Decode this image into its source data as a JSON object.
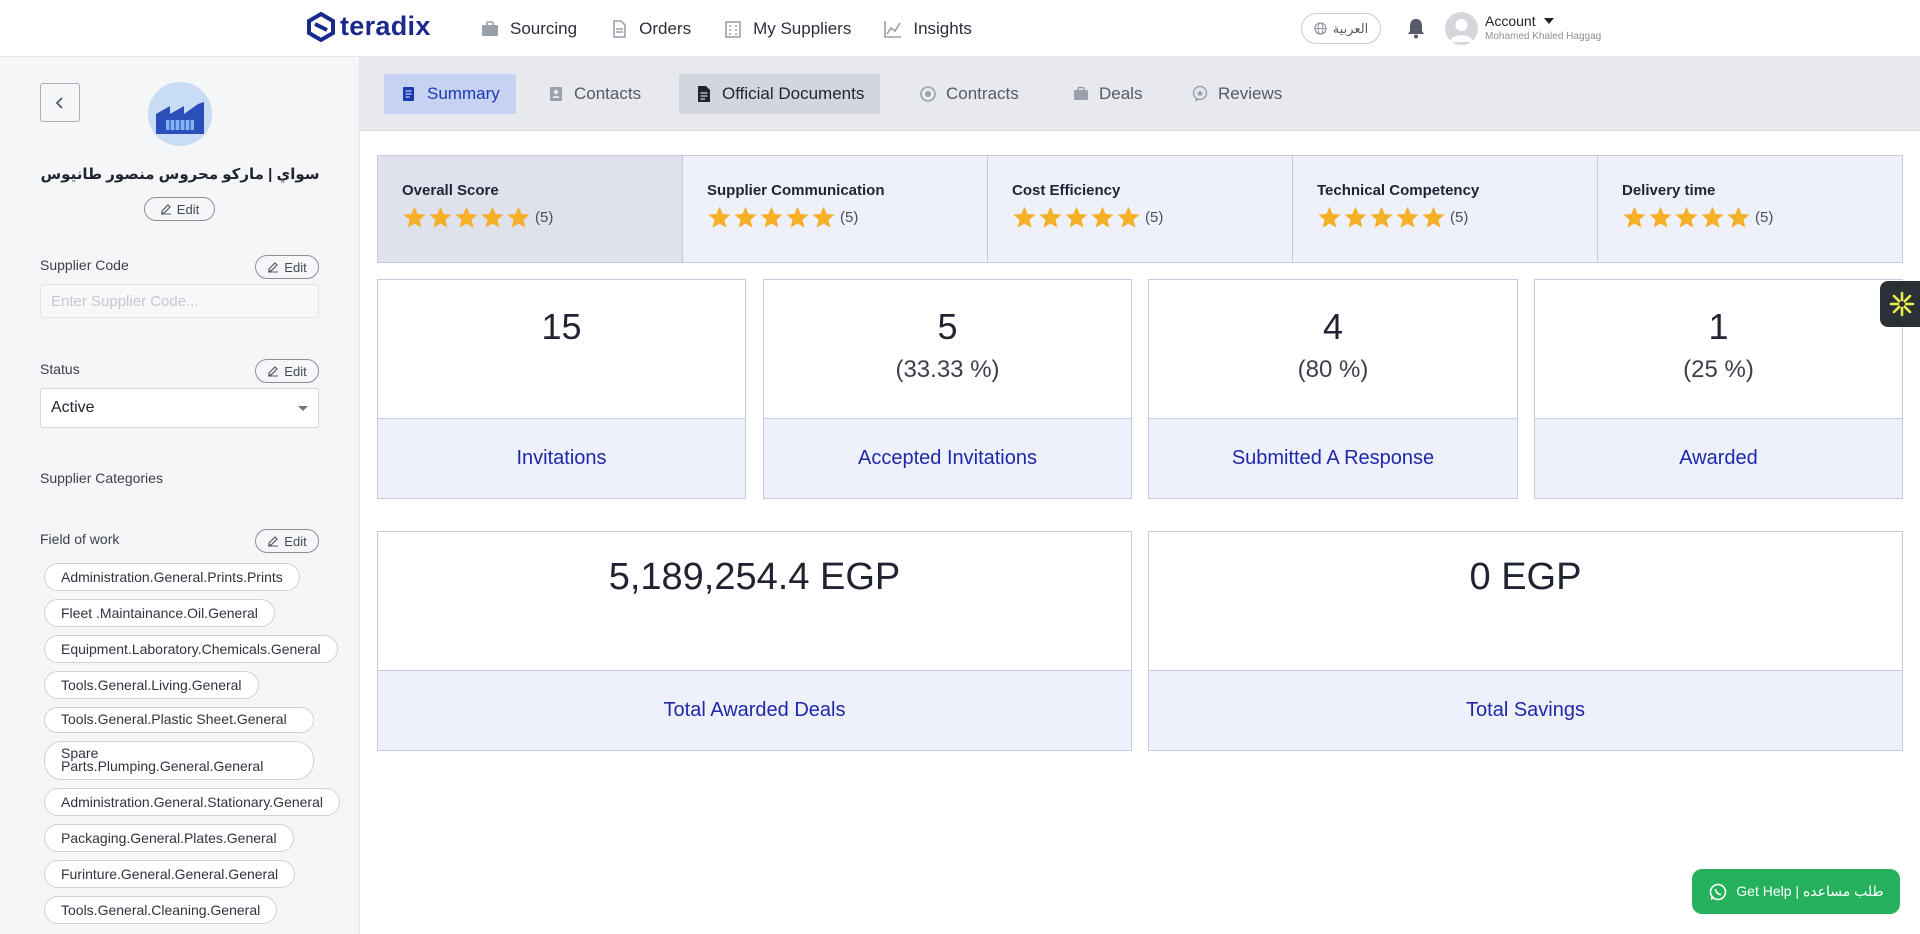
{
  "brand": {
    "name": "teradix",
    "color": "#1a2a8c"
  },
  "nav": [
    {
      "label": "Sourcing",
      "icon": "briefcase-icon"
    },
    {
      "label": "Orders",
      "icon": "document-icon"
    },
    {
      "label": "My Suppliers",
      "icon": "building-icon"
    },
    {
      "label": "Insights",
      "icon": "chart-line-icon"
    }
  ],
  "header": {
    "language": "العربية",
    "account_label": "Account",
    "user_name": "Mohamed Khaled Haggag"
  },
  "sidebar": {
    "supplier_name": "سواي | ماركو محروس منصور طانيوس",
    "edit_label": "Edit",
    "supplier_code_label": "Supplier Code",
    "supplier_code_placeholder": "Enter Supplier Code...",
    "status_label": "Status",
    "status_value": "Active",
    "categories_label": "Supplier Categories",
    "field_of_work_label": "Field of work",
    "fields": [
      "Administration.General.Prints.Prints",
      "Fleet .Maintainance.Oil.General",
      "Equipment.Laboratory.Chemicals.General",
      "Tools.General.Living.General",
      "Tools.General.Plastic Sheet.General",
      "Spare Parts.Plumping.General.General",
      "Administration.General.Stationary.General",
      "Packaging.General.Plates.General",
      "Furinture.General.General.General",
      "Tools.General.Cleaning.General"
    ]
  },
  "tabs": [
    {
      "label": "Summary",
      "icon": "summary-icon"
    },
    {
      "label": "Contacts",
      "icon": "contact-icon"
    },
    {
      "label": "Official Documents",
      "icon": "document-icon"
    },
    {
      "label": "Contracts",
      "icon": "contract-icon"
    },
    {
      "label": "Deals",
      "icon": "briefcase-icon"
    },
    {
      "label": "Reviews",
      "icon": "review-icon"
    }
  ],
  "scores": [
    {
      "title": "Overall Score",
      "rating": 5,
      "count": "(5)"
    },
    {
      "title": "Supplier Communication",
      "rating": 5,
      "count": "(5)"
    },
    {
      "title": "Cost Efficiency",
      "rating": 5,
      "count": "(5)"
    },
    {
      "title": "Technical Competency",
      "rating": 5,
      "count": "(5)"
    },
    {
      "title": "Delivery time",
      "rating": 5,
      "count": "(5)"
    }
  ],
  "stats": [
    {
      "value": "15",
      "percent": "",
      "label": "Invitations"
    },
    {
      "value": "5",
      "percent": "(33.33 %)",
      "label": "Accepted Invitations"
    },
    {
      "value": "4",
      "percent": "(80 %)",
      "label": "Submitted A Response"
    },
    {
      "value": "1",
      "percent": "(25 %)",
      "label": "Awarded"
    }
  ],
  "totals": [
    {
      "value": "5,189,254.4 EGP",
      "label": "Total Awarded Deals"
    },
    {
      "value": "0 EGP",
      "label": "Total Savings"
    }
  ],
  "help": {
    "label": "Get Help | طلب مساعده",
    "color": "#25b15c"
  },
  "colors": {
    "star": "#f5b027",
    "accent": "#1e28a8"
  }
}
